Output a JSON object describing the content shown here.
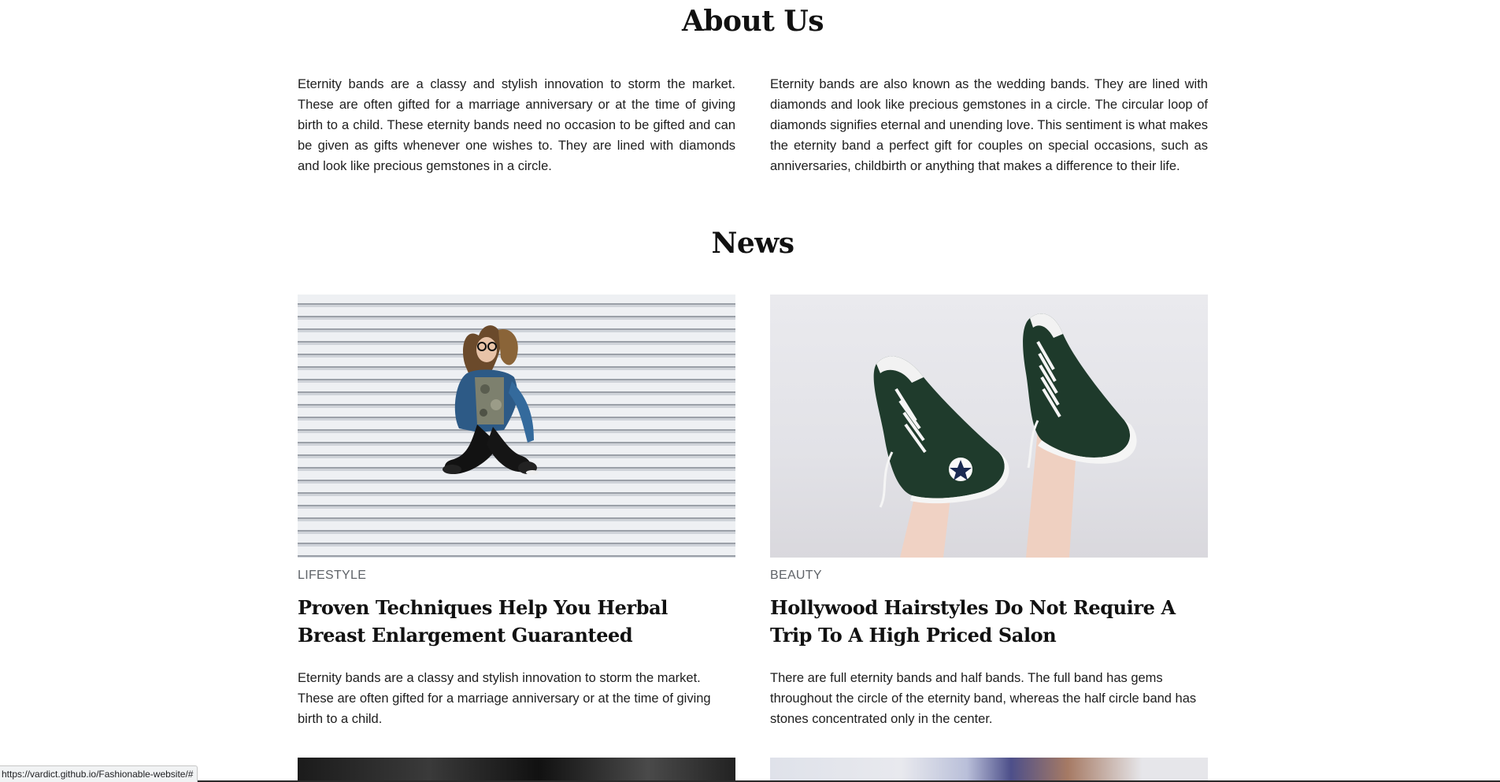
{
  "about": {
    "title": "About Us",
    "paragraphs": [
      "Eternity bands are a classy and stylish innovation to storm the market. These are often gifted for a marriage anniversary or at the time of giving birth to a child. These eternity bands need no occasion to be gifted and can be given as gifts whenever one wishes to. They are lined with diamonds and look like precious gemstones in a circle.",
      "Eternity bands are also known as the wedding bands. They are lined with diamonds and look like precious gemstones in a circle. The circular loop of diamonds signifies eternal and unending love. This sentiment is what makes the eternity band a perfect gift for couples on special occasions, such as anniversaries, childbirth or anything that makes a difference to their life."
    ]
  },
  "news": {
    "title": "News",
    "cards": [
      {
        "image": "woman-jumping-photo",
        "category": "LIFESTYLE",
        "title": "Proven Techniques Help You Herbal Breast Enlargement Guaranteed",
        "text": "Eternity bands are a classy and stylish innovation to storm the market. These are often gifted for a marriage anniversary or at the time of giving birth to a child."
      },
      {
        "image": "sneakers-photo",
        "category": "BEAUTY",
        "title": "Hollywood Hairstyles Do Not Require A Trip To A High Priced Salon",
        "text": "There are full eternity bands and half bands. The full band has gems throughout the circle of the eternity band, whereas the half circle band has stones concentrated only in the center."
      }
    ]
  },
  "status_bar": {
    "url": "https://vardict.github.io/Fashionable-website/#"
  }
}
